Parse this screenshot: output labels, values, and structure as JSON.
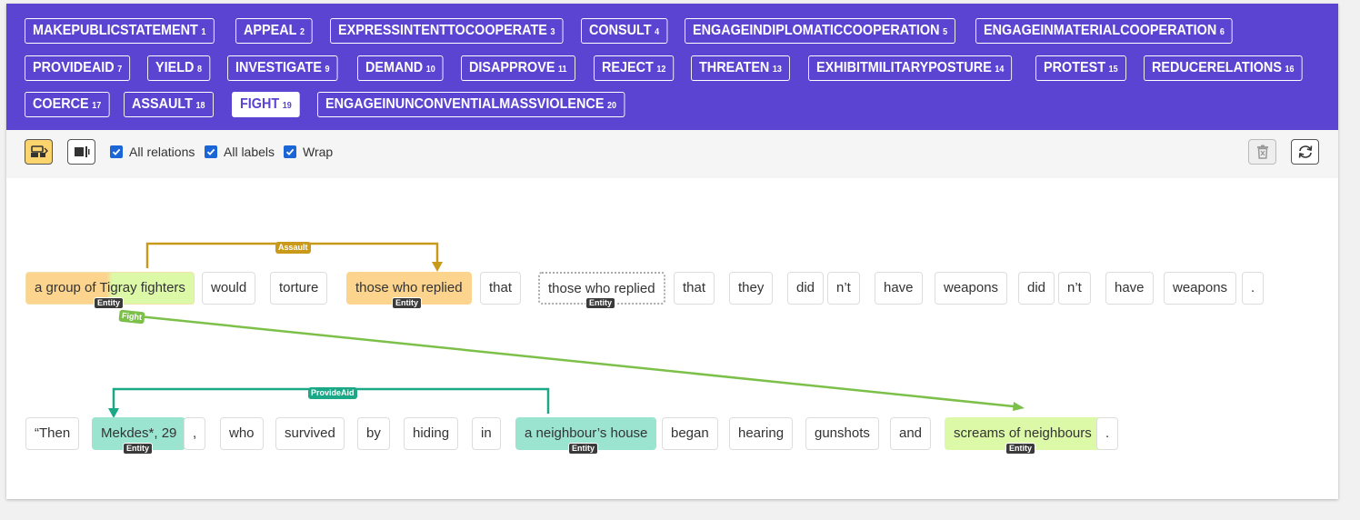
{
  "labels": [
    {
      "name": "MAKEPUBLICSTATEMENT",
      "num": "1"
    },
    {
      "name": "APPEAL",
      "num": "2"
    },
    {
      "name": "EXPRESSINTENTTOCOOPERATE",
      "num": "3"
    },
    {
      "name": "CONSULT",
      "num": "4"
    },
    {
      "name": "ENGAGEINDIPLOMATICCOOPERATION",
      "num": "5"
    },
    {
      "name": "ENGAGEINMATERIALCOOPERATION",
      "num": "6"
    },
    {
      "name": "PROVIDEAID",
      "num": "7"
    },
    {
      "name": "YIELD",
      "num": "8"
    },
    {
      "name": "INVESTIGATE",
      "num": "9"
    },
    {
      "name": "DEMAND",
      "num": "10"
    },
    {
      "name": "DISAPPROVE",
      "num": "11"
    },
    {
      "name": "REJECT",
      "num": "12"
    },
    {
      "name": "THREATEN",
      "num": "13"
    },
    {
      "name": "EXHIBITMILITARYPOSTURE",
      "num": "14"
    },
    {
      "name": "PROTEST",
      "num": "15"
    },
    {
      "name": "REDUCERELATIONS",
      "num": "16"
    },
    {
      "name": "COERCE",
      "num": "17"
    },
    {
      "name": "ASSAULT",
      "num": "18"
    },
    {
      "name": "FIGHT",
      "num": "19"
    },
    {
      "name": "ENGAGEINUNCONVENTIALMASSVIOLENCE",
      "num": "20"
    }
  ],
  "active_label": "FIGHT",
  "toolbar": {
    "all_relations": "All relations",
    "all_labels": "All labels",
    "wrap": "Wrap"
  },
  "sentence1": [
    "a group of Tigray fighters",
    "would",
    "torture",
    "those who replied",
    "that",
    "those who replied",
    "that",
    "they",
    "did",
    "n’t",
    "have",
    "weapons",
    "did",
    "n’t",
    "have",
    "weapons",
    "."
  ],
  "sentence2": [
    "“Then",
    "Mekdes*, 29",
    ",",
    "who",
    "survived",
    "by",
    "hiding",
    "in",
    "a neighbour’s house",
    "began",
    "hearing",
    "gunshots",
    "and",
    "screams of neighbours",
    "."
  ],
  "entity_badge": "Entity",
  "relations": {
    "assault": "Assault",
    "fight": "Fight",
    "provideaid": "ProvideAid"
  },
  "colors": {
    "label_bar": "#5b44d2",
    "assault": "#c99a1a",
    "fight": "#7cc04a",
    "provideaid": "#1aa886",
    "orange_span": "#fcd48d",
    "teal_span": "#9be4cf",
    "lime_span": "#dcf9a8"
  }
}
